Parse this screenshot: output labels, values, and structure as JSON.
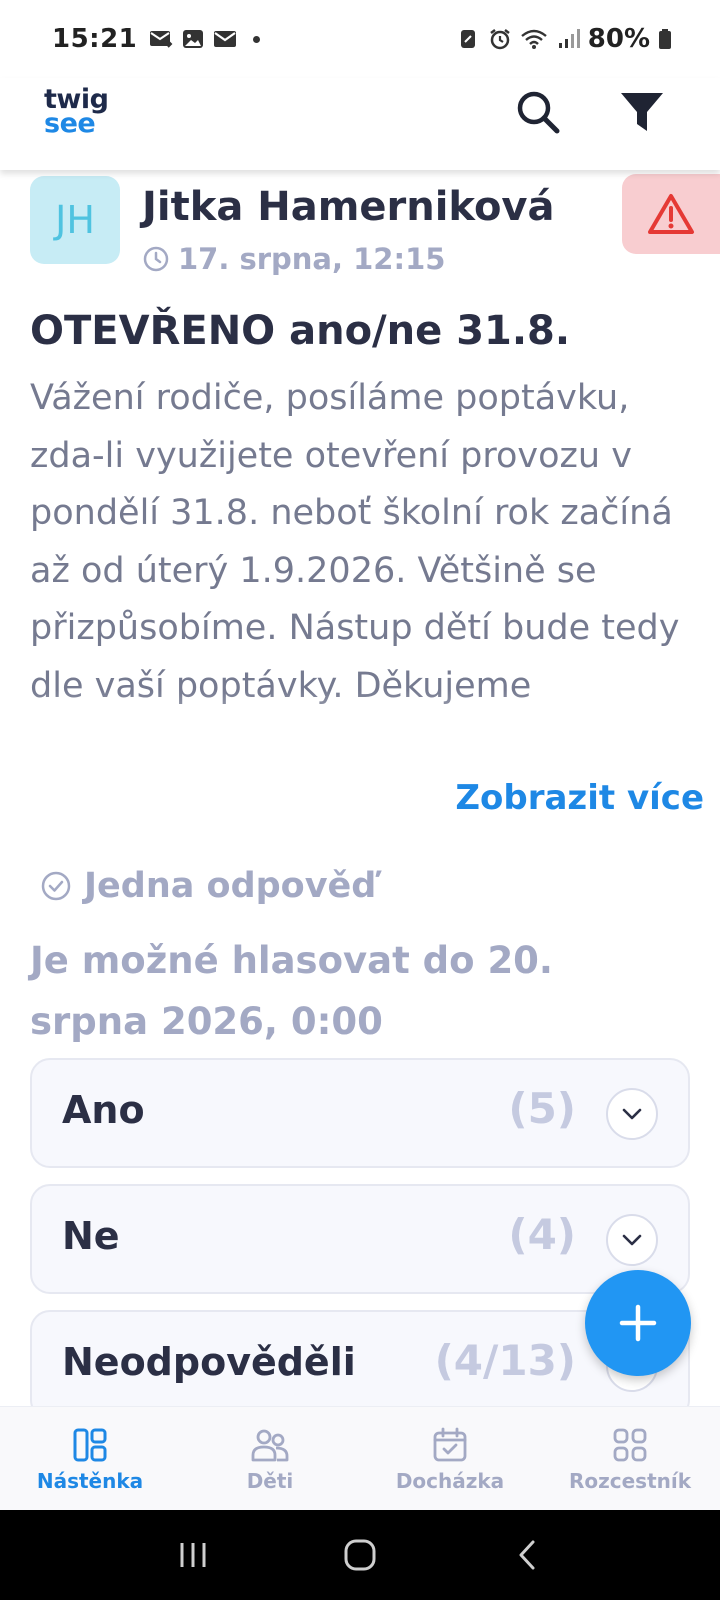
{
  "status_bar": {
    "time": "15:21",
    "battery": "80%"
  },
  "header": {
    "logo_line1": "twig",
    "logo_line2": "see"
  },
  "post": {
    "avatar_initials": "JH",
    "author": "Jitka Hamerniková",
    "time": "17. srpna, 12:15",
    "title": "OTEVŘENO ano/ne 31.8.",
    "body": "Vážení rodiče, posíláme poptávku, zda-li využijete otevření provozu v pondělí 31.8. neboť školní rok začíná až od úterý 1.9.2026. Většině se přizpůsobíme. Nástup dětí bude tedy dle vaší poptávky. Děkujeme",
    "show_more": "Zobrazit více"
  },
  "poll": {
    "type": "Jedna odpověď",
    "deadline": "Je možné hlasovat do 20. srpna 2026, 0:00",
    "options": [
      {
        "label": "Ano",
        "count": "(5)"
      },
      {
        "label": "Ne",
        "count": "(4)"
      },
      {
        "label": "Neodpověděli",
        "count": "(4/13)"
      }
    ]
  },
  "bottom_nav": {
    "items": [
      {
        "label": "Nástěnka",
        "active": true
      },
      {
        "label": "Děti",
        "active": false
      },
      {
        "label": "Docházka",
        "active": false
      },
      {
        "label": "Rozcestník",
        "active": false
      }
    ]
  },
  "colors": {
    "accent": "#1e88e5",
    "fab": "#2196f3",
    "text_dark": "#2b2f45",
    "text_muted": "#a3a9c4",
    "warning_bg": "#f8cdd0",
    "warning_icon": "#e53935",
    "avatar_bg": "#c7ecf5"
  }
}
